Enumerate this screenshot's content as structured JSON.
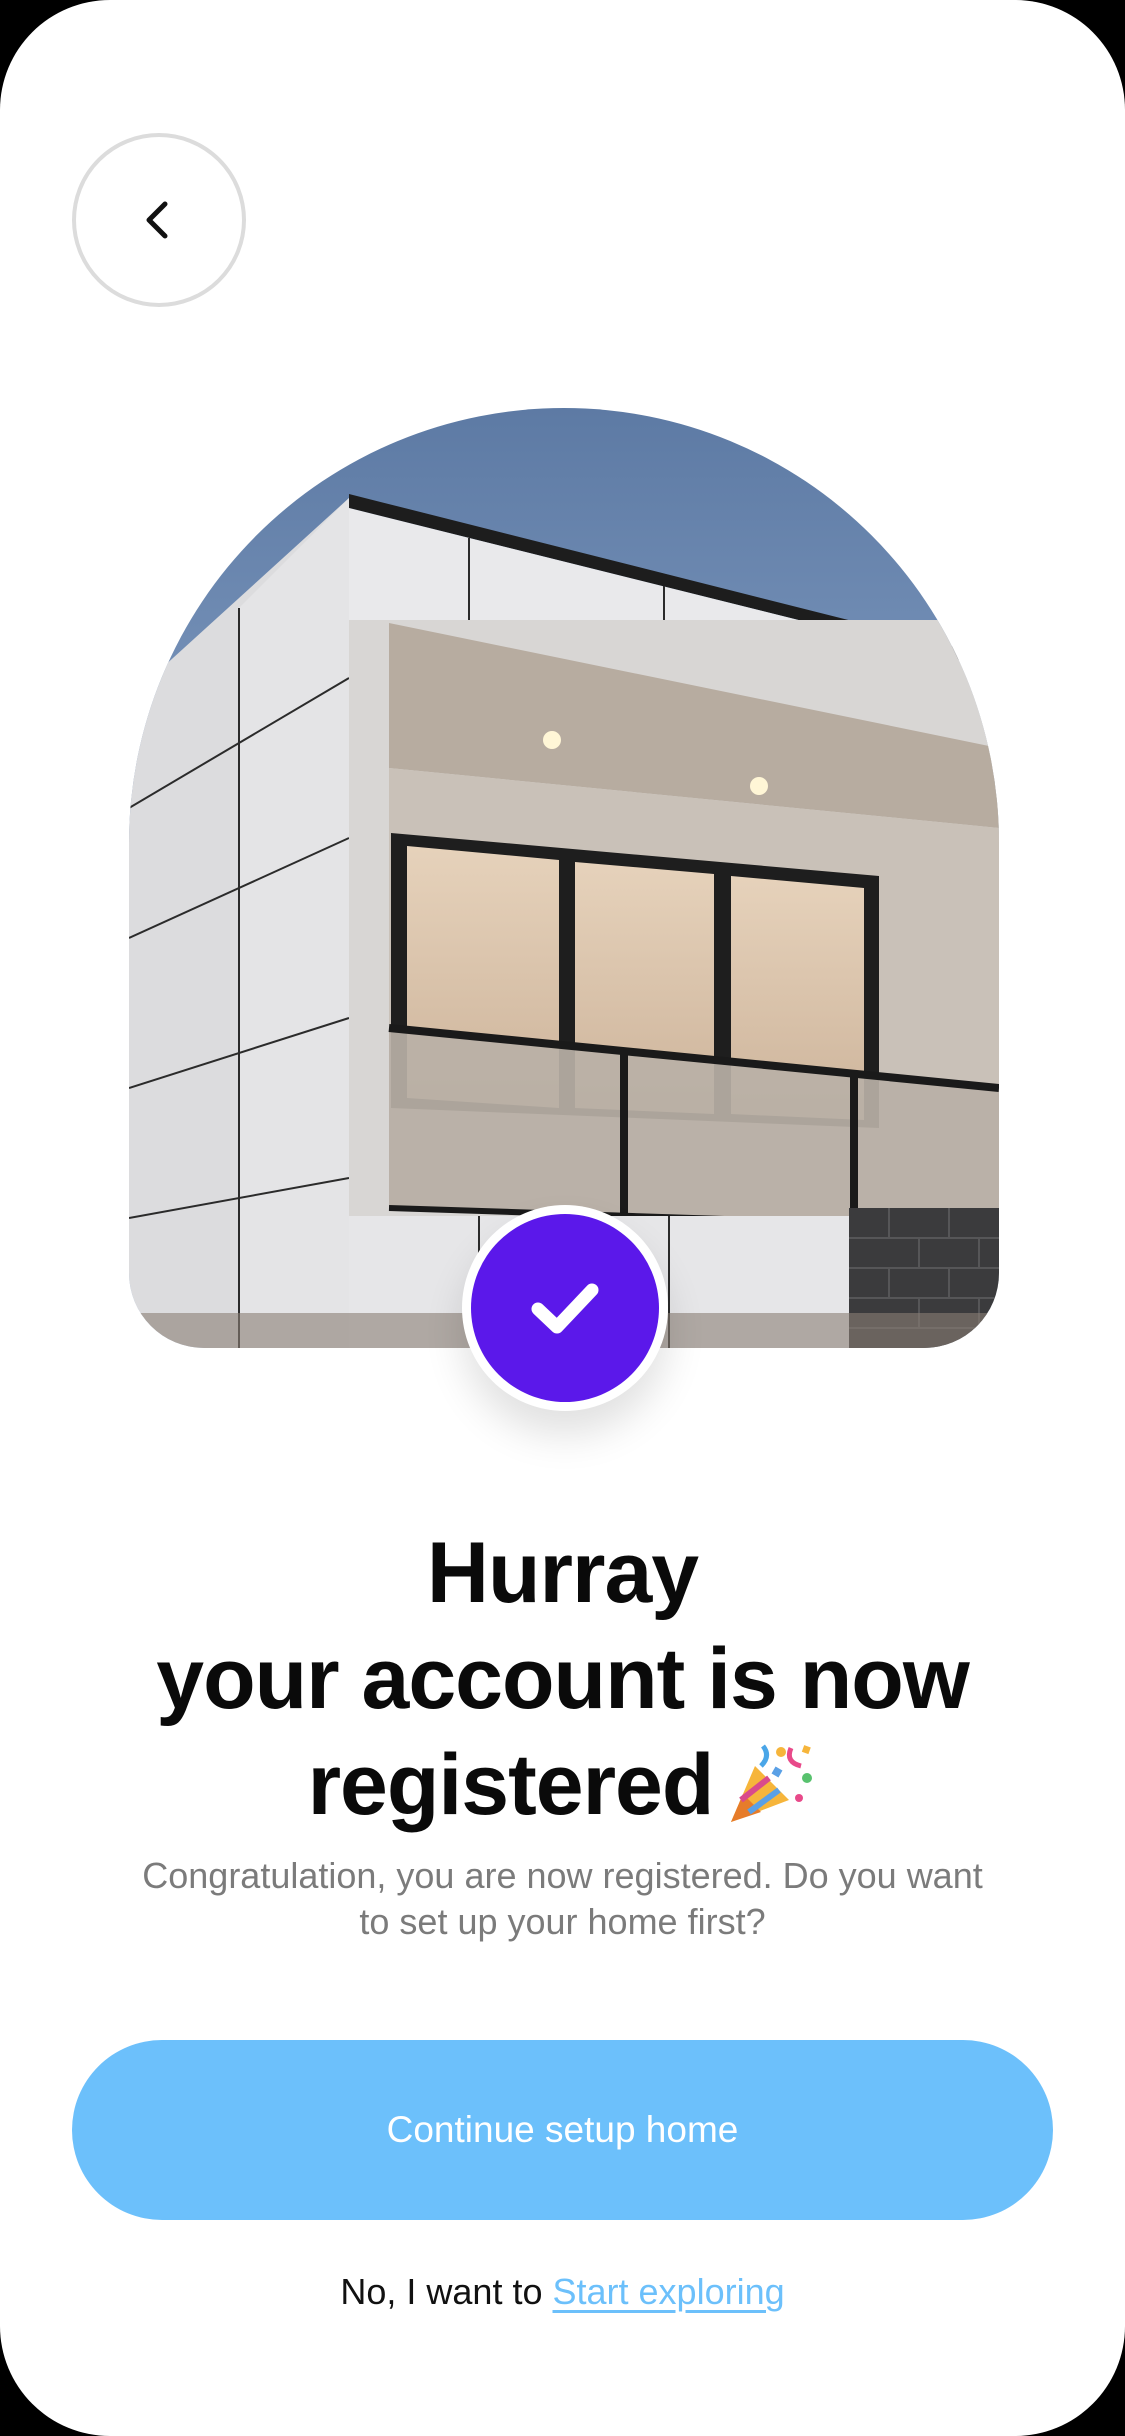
{
  "screen": {
    "back_icon": "chevron-left-icon",
    "hero_image": "modern-house-balcony-photo",
    "check_icon": "check-icon",
    "title": {
      "line1": "Hurray",
      "line2": "your account is now",
      "line3": "registered",
      "emoji_icon": "party-popper-icon"
    },
    "subtitle": "Congratulation, you are now registered. Do you want to set up your home first?",
    "primary_button": "Continue setup home",
    "footer": {
      "prefix": "No, I want to",
      "link": "Start exploring"
    }
  },
  "colors": {
    "accent_purple": "#5b18ea",
    "accent_blue": "#6cc0fb",
    "text_dark": "#0a0a0a",
    "text_muted": "#7b7b7b"
  }
}
